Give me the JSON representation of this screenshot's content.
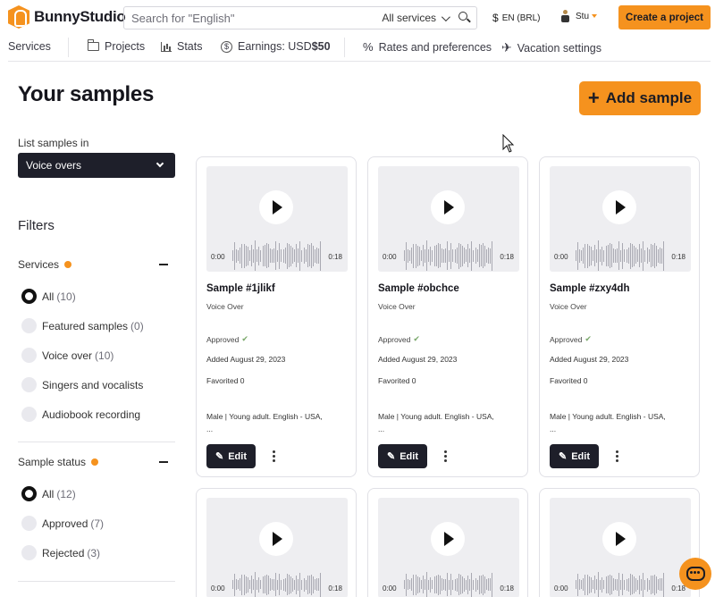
{
  "header": {
    "logo_text": "BunnyStudio",
    "search_placeholder": "Search for \"English\"",
    "search_scope": "All services",
    "currency_lang": "EN (BRL)",
    "currency_symbol": "$",
    "user_name": "Stu",
    "create_project_label": "Create a project"
  },
  "subnav": {
    "services": "Services",
    "projects": "Projects",
    "stats": "Stats",
    "earnings_prefix": "Earnings: USD ",
    "earnings_value": "$50",
    "rates": "Rates and preferences",
    "vacation": "Vacation settings"
  },
  "page": {
    "title": "Your samples",
    "add_label": "Add sample"
  },
  "sidebar": {
    "list_label": "List samples in",
    "list_value": "Voice overs",
    "filters_title": "Filters",
    "services": {
      "title": "Services",
      "options": [
        {
          "label": "All",
          "count": "(10)",
          "selected": true
        },
        {
          "label": "Featured samples",
          "count": "(0)",
          "selected": false
        },
        {
          "label": "Voice over",
          "count": "(10)",
          "selected": false
        },
        {
          "label": "Singers and vocalists",
          "count": "",
          "selected": false
        },
        {
          "label": "Audiobook recording",
          "count": "",
          "selected": false
        }
      ]
    },
    "status": {
      "title": "Sample status",
      "options": [
        {
          "label": "All",
          "count": "(12)",
          "selected": true
        },
        {
          "label": "Approved",
          "count": "(7)",
          "selected": false
        },
        {
          "label": "Rejected",
          "count": "(3)",
          "selected": false
        }
      ]
    }
  },
  "cards": [
    {
      "title": "Sample #1jlikf",
      "type": "Voice Over",
      "status": "Approved",
      "added": "Added August 29, 2023",
      "favorited": "Favorited 0",
      "desc": "Male | Young adult. English - USA,",
      "desc2": "...",
      "time_start": "0:00",
      "time_end": "0:18",
      "edit": "Edit"
    },
    {
      "title": "Sample #obchce",
      "type": "Voice Over",
      "status": "Approved",
      "added": "Added August 29, 2023",
      "favorited": "Favorited 0",
      "desc": "Male | Young adult. English - USA,",
      "desc2": "...",
      "time_start": "0:00",
      "time_end": "0:18",
      "edit": "Edit"
    },
    {
      "title": "Sample #zxy4dh",
      "type": "Voice Over",
      "status": "Approved",
      "added": "Added August 29, 2023",
      "favorited": "Favorited 0",
      "desc": "Male | Young adult. English - USA,",
      "desc2": "...",
      "time_start": "0:00",
      "time_end": "0:18",
      "edit": "Edit"
    },
    {
      "time_start": "0:00",
      "time_end": "0:18"
    },
    {
      "time_start": "0:00",
      "time_end": "0:18"
    },
    {
      "time_start": "0:00",
      "time_end": "0:18"
    }
  ],
  "colors": {
    "accent": "#f5921e",
    "dark": "#1e1f2a"
  }
}
